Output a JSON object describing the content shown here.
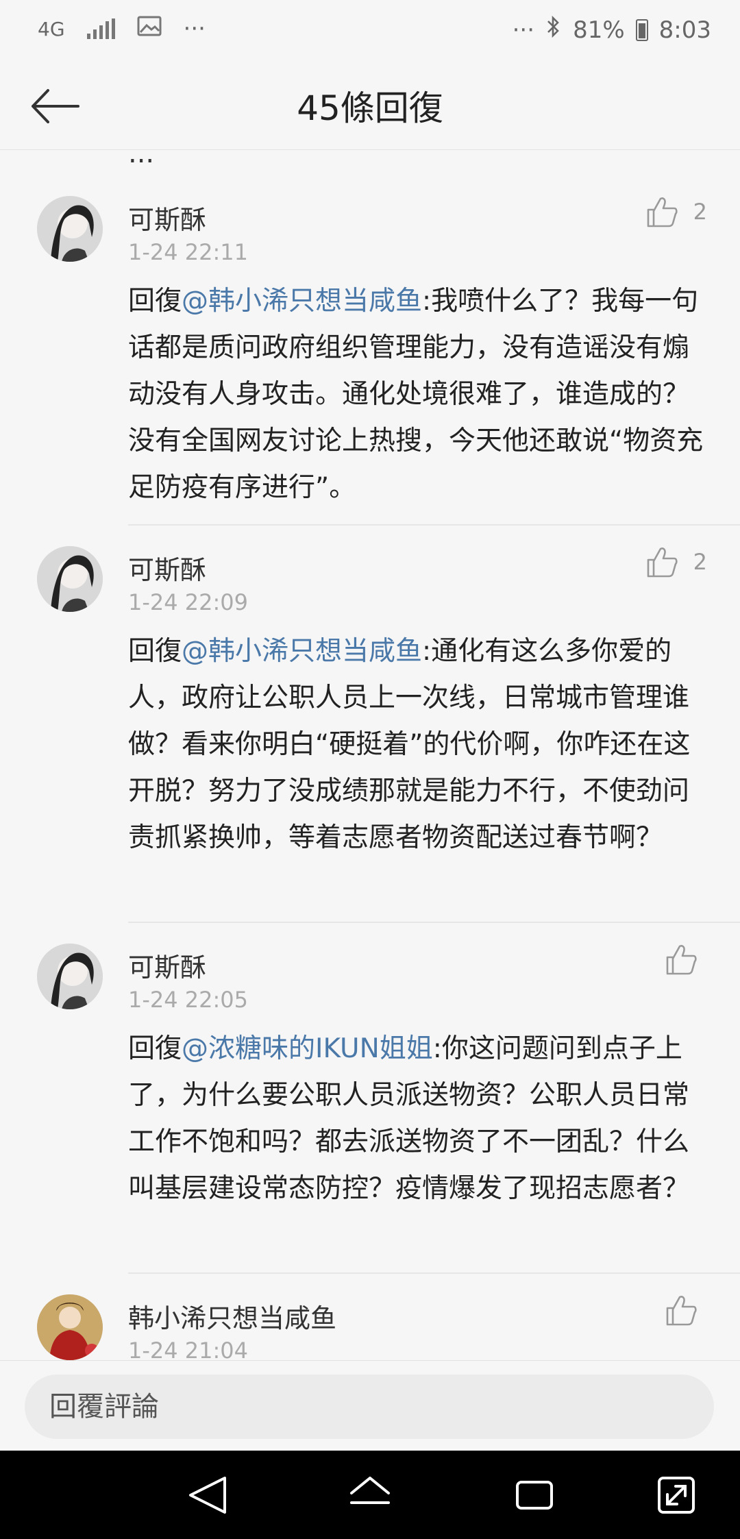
{
  "status_bar": {
    "network": "4G",
    "more_left": "···",
    "more_right": "···",
    "battery": "81%",
    "time": "8:03",
    "icons": [
      "network-4g-icon",
      "signal-icon",
      "gallery-icon",
      "bluetooth-icon",
      "battery-icon"
    ]
  },
  "header": {
    "title": "45條回復"
  },
  "peek": {
    "text_tail": "...",
    "mention": ""
  },
  "comments": [
    {
      "author": "可斯酥",
      "time": "1-24 22:11",
      "likes": "2",
      "reply_prefix": "回復",
      "mention": "@韩小浠只想当咸鱼",
      "body": ":我喷什么了？我每一句话都是质问政府组织管理能力，没有造谣没有煽动没有人身攻击。通化处境很难了，谁造成的？没有全国网友讨论上热搜，今天他还敢说“物资充足防疫有序进行”。"
    },
    {
      "author": "可斯酥",
      "time": "1-24 22:09",
      "likes": "2",
      "reply_prefix": "回復",
      "mention": "@韩小浠只想当咸鱼",
      "body": ":通化有这么多你爱的人，政府让公职人员上一次线，日常城市管理谁做？看来你明白“硬挺着”的代价啊，你咋还在这开脱？努力了没成绩那就是能力不行，不使劲问责抓紧换帅，等着志愿者物资配送过春节啊？"
    },
    {
      "author": "可斯酥",
      "time": "1-24 22:05",
      "likes": "",
      "reply_prefix": "回復",
      "mention": "@浓糖味的IKUN姐姐",
      "body": ":你这问题问到点子上了，为什么要公职人员派送物资？公职人员日常工作不饱和吗？都去派送物资了不一团乱？什么叫基层建设常态防控？疫情爆发了现招志愿者？"
    },
    {
      "author": "韩小浠只想当咸鱼",
      "time": "1-24 21:04",
      "likes": "",
      "reply_prefix": "",
      "mention": "",
      "body": ""
    }
  ],
  "reply_bar": {
    "placeholder": "回覆評論"
  },
  "nav": {
    "icons": [
      "back-triangle-icon",
      "home-icon",
      "recents-icon",
      "expand-icon"
    ]
  },
  "colors": {
    "mention": "#4a78a8",
    "background": "#f6f6f6",
    "nav": "#000000"
  }
}
